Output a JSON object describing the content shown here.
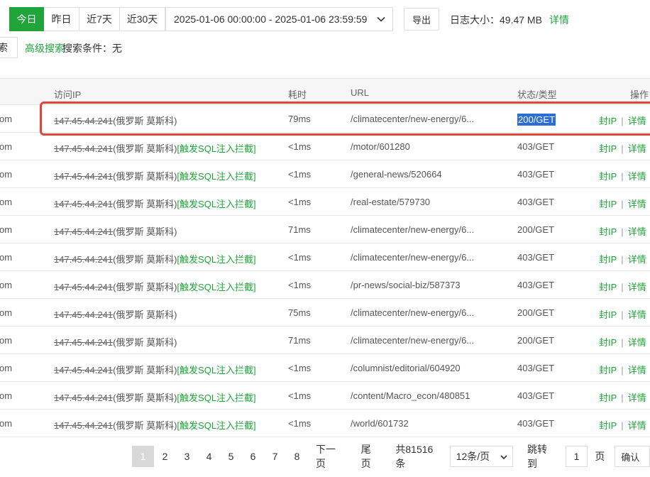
{
  "toolbar": {
    "tabs": [
      "今日",
      "昨日",
      "近7天",
      "近30天"
    ],
    "date_range": "2025-01-06 00:00:00 - 2025-01-06 23:59:59",
    "export_label": "导出",
    "log_size": "日志大小：49.47 MB",
    "log_detail": "详情",
    "search_label": "索",
    "advanced_search": "高级搜索",
    "search_condition": "搜索条件：无"
  },
  "table": {
    "headers": [
      "访问IP",
      "耗时",
      "URL",
      "状态/类型",
      "操作"
    ],
    "rows": [
      {
        "host": "om",
        "ip": "147.45.44.241",
        "loc": "(俄罗斯 莫斯科)",
        "flag": "",
        "time": "79ms",
        "url": "/climatecenter/new-energy/6...",
        "status": "200/GET"
      },
      {
        "host": "om",
        "ip": "147.45.44.241",
        "loc": "(俄罗斯 莫斯科)",
        "flag": "[触发SQL注入拦截]",
        "time": "<1ms",
        "url": "/motor/601280",
        "status": "403/GET"
      },
      {
        "host": "om",
        "ip": "147.45.44.241",
        "loc": "(俄罗斯 莫斯科)",
        "flag": "[触发SQL注入拦截]",
        "time": "<1ms",
        "url": "/general-news/520664",
        "status": "403/GET"
      },
      {
        "host": "om",
        "ip": "147.45.44.241",
        "loc": "(俄罗斯 莫斯科)",
        "flag": "[触发SQL注入拦截]",
        "time": "<1ms",
        "url": "/real-estate/579730",
        "status": "403/GET"
      },
      {
        "host": "om",
        "ip": "147.45.44.241",
        "loc": "(俄罗斯 莫斯科)",
        "flag": "",
        "time": "71ms",
        "url": "/climatecenter/new-energy/6...",
        "status": "200/GET"
      },
      {
        "host": "om",
        "ip": "147.45.44.241",
        "loc": "(俄罗斯 莫斯科)",
        "flag": "[触发SQL注入拦截]",
        "time": "<1ms",
        "url": "/climatecenter/new-energy/6...",
        "status": "403/GET"
      },
      {
        "host": "om",
        "ip": "147.45.44.241",
        "loc": "(俄罗斯 莫斯科)",
        "flag": "[触发SQL注入拦截]",
        "time": "<1ms",
        "url": "/pr-news/social-biz/587373",
        "status": "403/GET"
      },
      {
        "host": "om",
        "ip": "147.45.44.241",
        "loc": "(俄罗斯 莫斯科)",
        "flag": "",
        "time": "75ms",
        "url": "/climatecenter/new-energy/6...",
        "status": "200/GET"
      },
      {
        "host": "om",
        "ip": "147.45.44.241",
        "loc": "(俄罗斯 莫斯科)",
        "flag": "",
        "time": "71ms",
        "url": "/climatecenter/new-energy/6...",
        "status": "200/GET"
      },
      {
        "host": "om",
        "ip": "147.45.44.241",
        "loc": "(俄罗斯 莫斯科)",
        "flag": "[触发SQL注入拦截]",
        "time": "<1ms",
        "url": "/columnist/editorial/604920",
        "status": "403/GET"
      },
      {
        "host": "om",
        "ip": "147.45.44.241",
        "loc": "(俄罗斯 莫斯科)",
        "flag": "[触发SQL注入拦截]",
        "time": "<1ms",
        "url": "/content/Macro_econ/480851",
        "status": "403/GET"
      },
      {
        "host": "om",
        "ip": "147.45.44.241",
        "loc": "(俄罗斯 莫斯科)",
        "flag": "[触发SQL注入拦截]",
        "time": "<1ms",
        "url": "/world/601732",
        "status": "403/GET"
      }
    ],
    "ops": {
      "block": "封IP",
      "sep": "|",
      "detail": "详情"
    }
  },
  "pager": {
    "pages": [
      "1",
      "2",
      "3",
      "4",
      "5",
      "6",
      "7",
      "8"
    ],
    "next": "下一页",
    "last": "尾页",
    "total": "共81516条",
    "page_size": "12条/页",
    "jump_label": "跳转到",
    "jump_value": "1",
    "page_unit": "页",
    "confirm": "确认"
  },
  "colors": {
    "accent": "#20a53a",
    "highlight_box": "#e0463a",
    "selection": "#2b6fd6"
  }
}
